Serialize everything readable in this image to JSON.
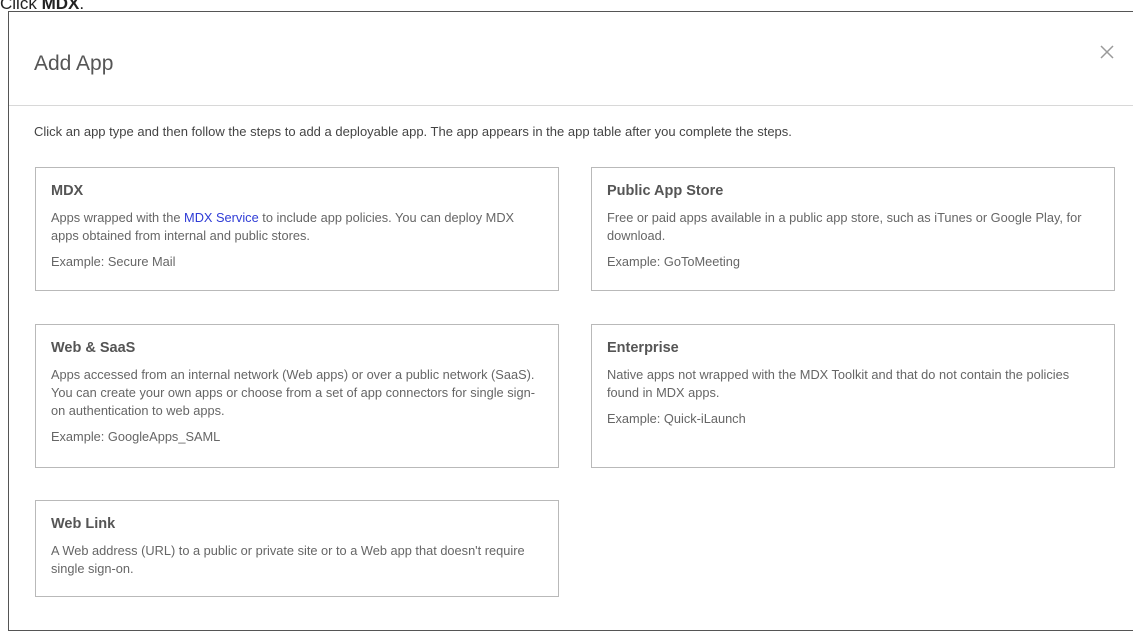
{
  "instruction": {
    "prefix": "Click ",
    "bold": "MDX",
    "suffix": "."
  },
  "dialog": {
    "title": "Add App",
    "close_icon": "close-icon",
    "intro": "Click an app type and then follow the steps to add a deployable app. The app appears in the app table after you complete the steps."
  },
  "cards": {
    "mdx": {
      "title": "MDX",
      "desc_before_link": "Apps wrapped with the ",
      "link": "MDX Service",
      "desc_after_link": " to include app policies. You can deploy MDX apps obtained from internal and public stores.",
      "example": "Example: Secure Mail"
    },
    "public_app_store": {
      "title": "Public App Store",
      "desc": "Free or paid apps available in a public app store, such as iTunes or Google Play, for download.",
      "example": "Example: GoToMeeting"
    },
    "web_saas": {
      "title": "Web & SaaS",
      "desc": "Apps accessed from an internal network (Web apps) or over a public network (SaaS). You can create your own apps or choose from a set of app connectors for single sign-on authentication to web apps.",
      "example": "Example: GoogleApps_SAML"
    },
    "enterprise": {
      "title": "Enterprise",
      "desc": "Native apps not wrapped with the MDX Toolkit and that do not contain the policies found in MDX apps.",
      "example": "Example: Quick-iLaunch"
    },
    "web_link": {
      "title": "Web Link",
      "desc": "A Web address (URL) to a public or private site or to a Web app that doesn't require single sign-on."
    }
  },
  "colors": {
    "link": "#2f3cd6",
    "card_border": "#b9b9b9",
    "dialog_border": "#555555"
  }
}
